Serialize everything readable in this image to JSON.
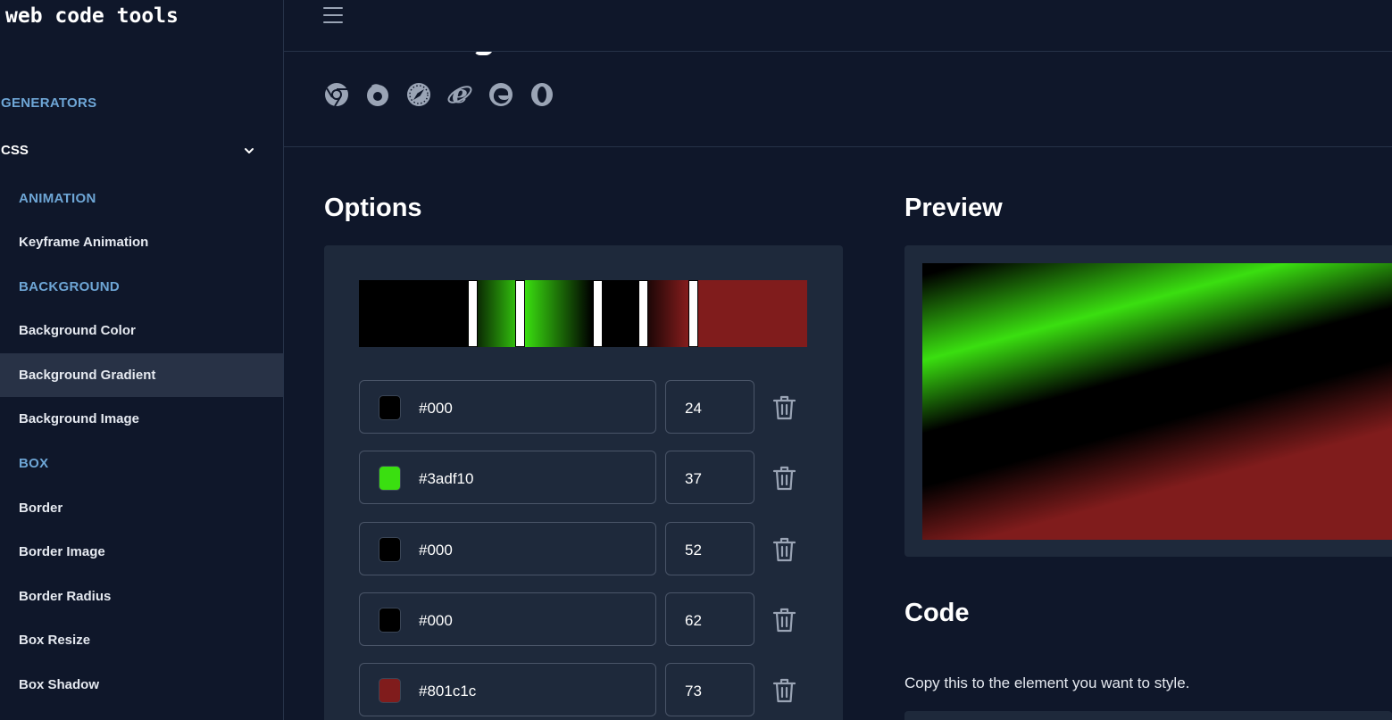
{
  "brand": "web code tools",
  "sidebar": {
    "generators_label": "GENERATORS",
    "css_label": "CSS",
    "groups": {
      "animation": "ANIMATION",
      "background": "BACKGROUND",
      "box": "BOX"
    },
    "items": {
      "keyframe_animation": "Keyframe Animation",
      "background_color": "Background Color",
      "background_gradient": "Background Gradient",
      "background_image": "Background Image",
      "border": "Border",
      "border_image": "Border Image",
      "border_radius": "Border Radius",
      "box_resize": "Box Resize",
      "box_shadow": "Box Shadow"
    },
    "active_item": "Background Gradient"
  },
  "browsers": [
    "chrome-icon",
    "firefox-icon",
    "safari-icon",
    "ie-icon",
    "edge-icon",
    "opera-icon"
  ],
  "options": {
    "heading": "Options",
    "stops": [
      {
        "color": "#000",
        "swatch": "#000000",
        "position": "24"
      },
      {
        "color": "#3adf10",
        "swatch": "#3adf10",
        "position": "37"
      },
      {
        "color": "#000",
        "swatch": "#000000",
        "position": "52"
      },
      {
        "color": "#000",
        "swatch": "#000000",
        "position": "62"
      },
      {
        "color": "#801c1c",
        "swatch": "#801c1c",
        "position": "73"
      }
    ]
  },
  "preview": {
    "heading": "Preview"
  },
  "code": {
    "heading": "Code",
    "note": "Copy this to the element you want to style."
  },
  "colors": {
    "background": "#0f172a",
    "panel": "#1e293b",
    "accent": "#6ea6d6",
    "active_row": "#283246"
  }
}
